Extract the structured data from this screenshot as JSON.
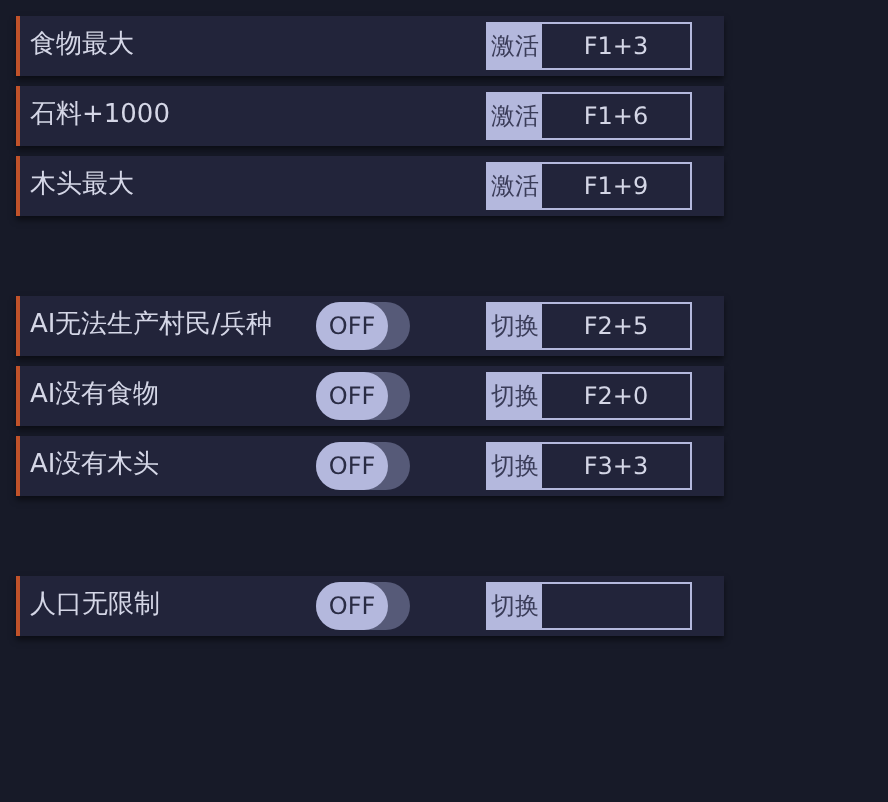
{
  "sections": [
    {
      "rows": [
        {
          "kind": "activate",
          "label": "食物最大",
          "action": "激活",
          "hotkey": "F1+3"
        },
        {
          "kind": "activate",
          "label": "石料+1000",
          "action": "激活",
          "hotkey": "F1+6"
        },
        {
          "kind": "activate",
          "label": "木头最大",
          "action": "激活",
          "hotkey": "F1+9"
        }
      ]
    },
    {
      "rows": [
        {
          "kind": "toggle",
          "label": "AI无法生产村民/兵种",
          "toggle_text": "OFF",
          "on": false,
          "action": "切换",
          "hotkey": "F2+5"
        },
        {
          "kind": "toggle",
          "label": "AI没有食物",
          "toggle_text": "OFF",
          "on": false,
          "action": "切换",
          "hotkey": "F2+0"
        },
        {
          "kind": "toggle",
          "label": "AI没有木头",
          "toggle_text": "OFF",
          "on": false,
          "action": "切换",
          "hotkey": "F3+3"
        }
      ]
    },
    {
      "rows": [
        {
          "kind": "toggle",
          "label": "人口无限制",
          "toggle_text": "OFF",
          "on": false,
          "action": "切换"
        }
      ]
    }
  ]
}
